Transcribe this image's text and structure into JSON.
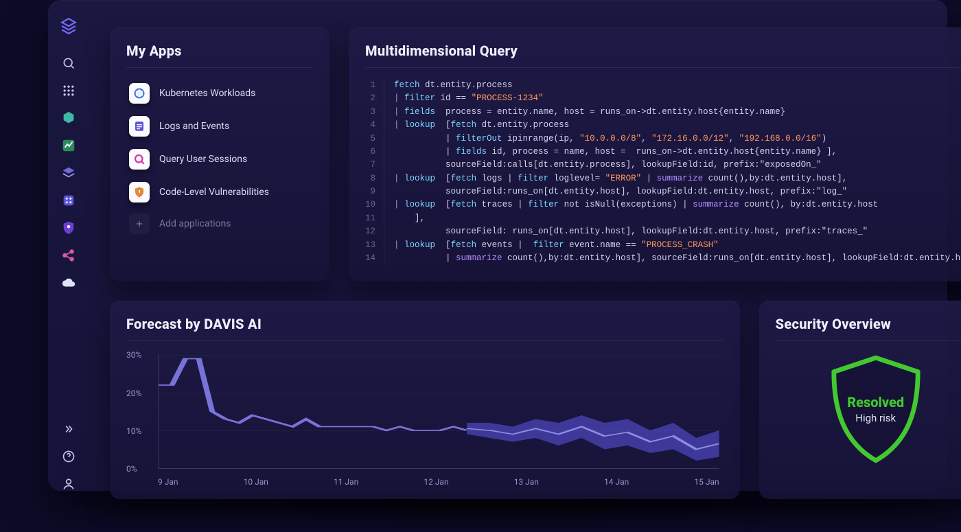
{
  "sidebar": {
    "logo": "cube-logo",
    "icons": [
      "search-icon",
      "apps-grid-icon",
      "hex-icon",
      "chart-icon",
      "layers-icon",
      "dice-icon",
      "shield-user-icon",
      "share-icon",
      "cloud-icon"
    ],
    "bottom_icons": [
      "expand-icon",
      "help-icon",
      "user-icon"
    ]
  },
  "my_apps": {
    "title": "My Apps",
    "items": [
      {
        "icon": "kubernetes-icon",
        "label": "Kubernetes Workloads"
      },
      {
        "icon": "logs-icon",
        "label": "Logs and Events"
      },
      {
        "icon": "query-icon",
        "label": "Query User Sessions"
      },
      {
        "icon": "vuln-icon",
        "label": "Code-Level Vulnerabilities"
      }
    ],
    "add_label": "Add applications"
  },
  "query": {
    "title": "Multidimensional Query",
    "lines": [
      {
        "n": 1,
        "tokens": [
          [
            "cmd",
            "fetch"
          ],
          [
            " ",
            " dt.entity.process"
          ]
        ]
      },
      {
        "n": 2,
        "tokens": [
          [
            "op",
            "| "
          ],
          [
            "cmd",
            "filter"
          ],
          [
            " ",
            " id == "
          ],
          [
            "str",
            "\"PROCESS-1234\""
          ]
        ]
      },
      {
        "n": 3,
        "tokens": [
          [
            "op",
            "| "
          ],
          [
            "cmd",
            "fields"
          ],
          [
            " ",
            "  process = entity.name, host = runs_on->dt.entity.host{entity.name}"
          ]
        ]
      },
      {
        "n": 4,
        "tokens": [
          [
            "op",
            "| "
          ],
          [
            "cmd",
            "lookup"
          ],
          [
            " ",
            "  ["
          ],
          [
            "cmd",
            "fetch"
          ],
          [
            " ",
            " dt.entity.process"
          ]
        ]
      },
      {
        "n": 5,
        "tokens": [
          [
            " ",
            "          | "
          ],
          [
            "cmd",
            "filterOut"
          ],
          [
            " ",
            " ipinrange(ip, "
          ],
          [
            "str",
            "\"10.0.0.0/8\""
          ],
          [
            " ",
            ", "
          ],
          [
            "str",
            "\"172.16.0.0/12\""
          ],
          [
            " ",
            ", "
          ],
          [
            "str",
            "\"192.168.0.0/16\""
          ],
          [
            " ",
            ")"
          ]
        ]
      },
      {
        "n": 6,
        "tokens": [
          [
            " ",
            "          | "
          ],
          [
            "cmd",
            "fields"
          ],
          [
            " ",
            " id, process = name, host =  runs_on->dt.entity.host{entity.name} ],"
          ]
        ]
      },
      {
        "n": 7,
        "tokens": [
          [
            " ",
            "          sourceField:calls[dt.entity.process], lookupField:id, prefix:\"exposedOn_\""
          ]
        ]
      },
      {
        "n": 8,
        "tokens": [
          [
            "op",
            "| "
          ],
          [
            "cmd",
            "lookup"
          ],
          [
            " ",
            "  ["
          ],
          [
            "cmd",
            "fetch"
          ],
          [
            " ",
            " logs | "
          ],
          [
            "cmd",
            "filter"
          ],
          [
            " ",
            " loglevel= "
          ],
          [
            "str",
            "\"ERROR\""
          ],
          [
            " ",
            " | "
          ],
          [
            "summ",
            "summarize"
          ],
          [
            " ",
            " count(),by:dt.entity.host],"
          ]
        ]
      },
      {
        "n": 9,
        "tokens": [
          [
            " ",
            "          sourceField:runs_on[dt.entity.host], lookupField:dt.entity.host, prefix:\"log_\""
          ]
        ]
      },
      {
        "n": 10,
        "tokens": [
          [
            "op",
            "| "
          ],
          [
            "cmd",
            "lookup"
          ],
          [
            " ",
            "  ["
          ],
          [
            "cmd",
            "fetch"
          ],
          [
            " ",
            " traces | "
          ],
          [
            "cmd",
            "filter"
          ],
          [
            " ",
            " not isNull(exceptions) | "
          ],
          [
            "summ",
            "summarize"
          ],
          [
            " ",
            " count(), by:dt.entity.host"
          ]
        ]
      },
      {
        "n": 11,
        "tokens": [
          [
            " ",
            "    ],"
          ]
        ]
      },
      {
        "n": 12,
        "tokens": [
          [
            " ",
            "          sourceField: runs_on[dt.entity.host], lookupField:dt.entity.host, prefix:\"traces_\""
          ]
        ]
      },
      {
        "n": 13,
        "tokens": [
          [
            "op",
            "| "
          ],
          [
            "cmd",
            "lookup"
          ],
          [
            " ",
            "  ["
          ],
          [
            "cmd",
            "fetch"
          ],
          [
            " ",
            " events |  "
          ],
          [
            "cmd",
            "filter"
          ],
          [
            " ",
            " event.name == "
          ],
          [
            "str",
            "\"PROCESS_CRASH\""
          ]
        ]
      },
      {
        "n": 14,
        "tokens": [
          [
            " ",
            "          | "
          ],
          [
            "summ",
            "summarize"
          ],
          [
            " ",
            " count(),by:dt.entity.host], sourceField:runs_on[dt.entity.host], lookupField:dt.entity.host"
          ]
        ]
      }
    ]
  },
  "forecast": {
    "title": "Forecast by DAVIS AI"
  },
  "chart_data": {
    "type": "line",
    "title": "Forecast by DAVIS AI",
    "ylabel": "%",
    "ylim": [
      0,
      30
    ],
    "yticks": [
      "0%",
      "10%",
      "20%",
      "30%"
    ],
    "x": [
      "9 Jan",
      "10 Jan",
      "11 Jan",
      "12 Jan",
      "13 Jan",
      "14 Jan",
      "15 Jan"
    ],
    "series": [
      {
        "name": "actual",
        "color": "#7873d9",
        "values": [
          22,
          22,
          29,
          29,
          15,
          13,
          12,
          14,
          13,
          12,
          11,
          13,
          11,
          11,
          11,
          11,
          11,
          10,
          11,
          10,
          10,
          10,
          11,
          10
        ]
      },
      {
        "name": "forecast_band",
        "color": "#4b45b8",
        "band": true,
        "upper": [
          12,
          12,
          11,
          13,
          12,
          14,
          12,
          13,
          10,
          12,
          8,
          10
        ],
        "lower": [
          9,
          8,
          7,
          8,
          6,
          8,
          5,
          6,
          4,
          5,
          2,
          3
        ]
      }
    ],
    "forecast_start_fraction": 0.55
  },
  "security": {
    "title": "Security Overview",
    "status": "Resolved",
    "status_color": "#42c92f",
    "risk_label": "High risk"
  }
}
